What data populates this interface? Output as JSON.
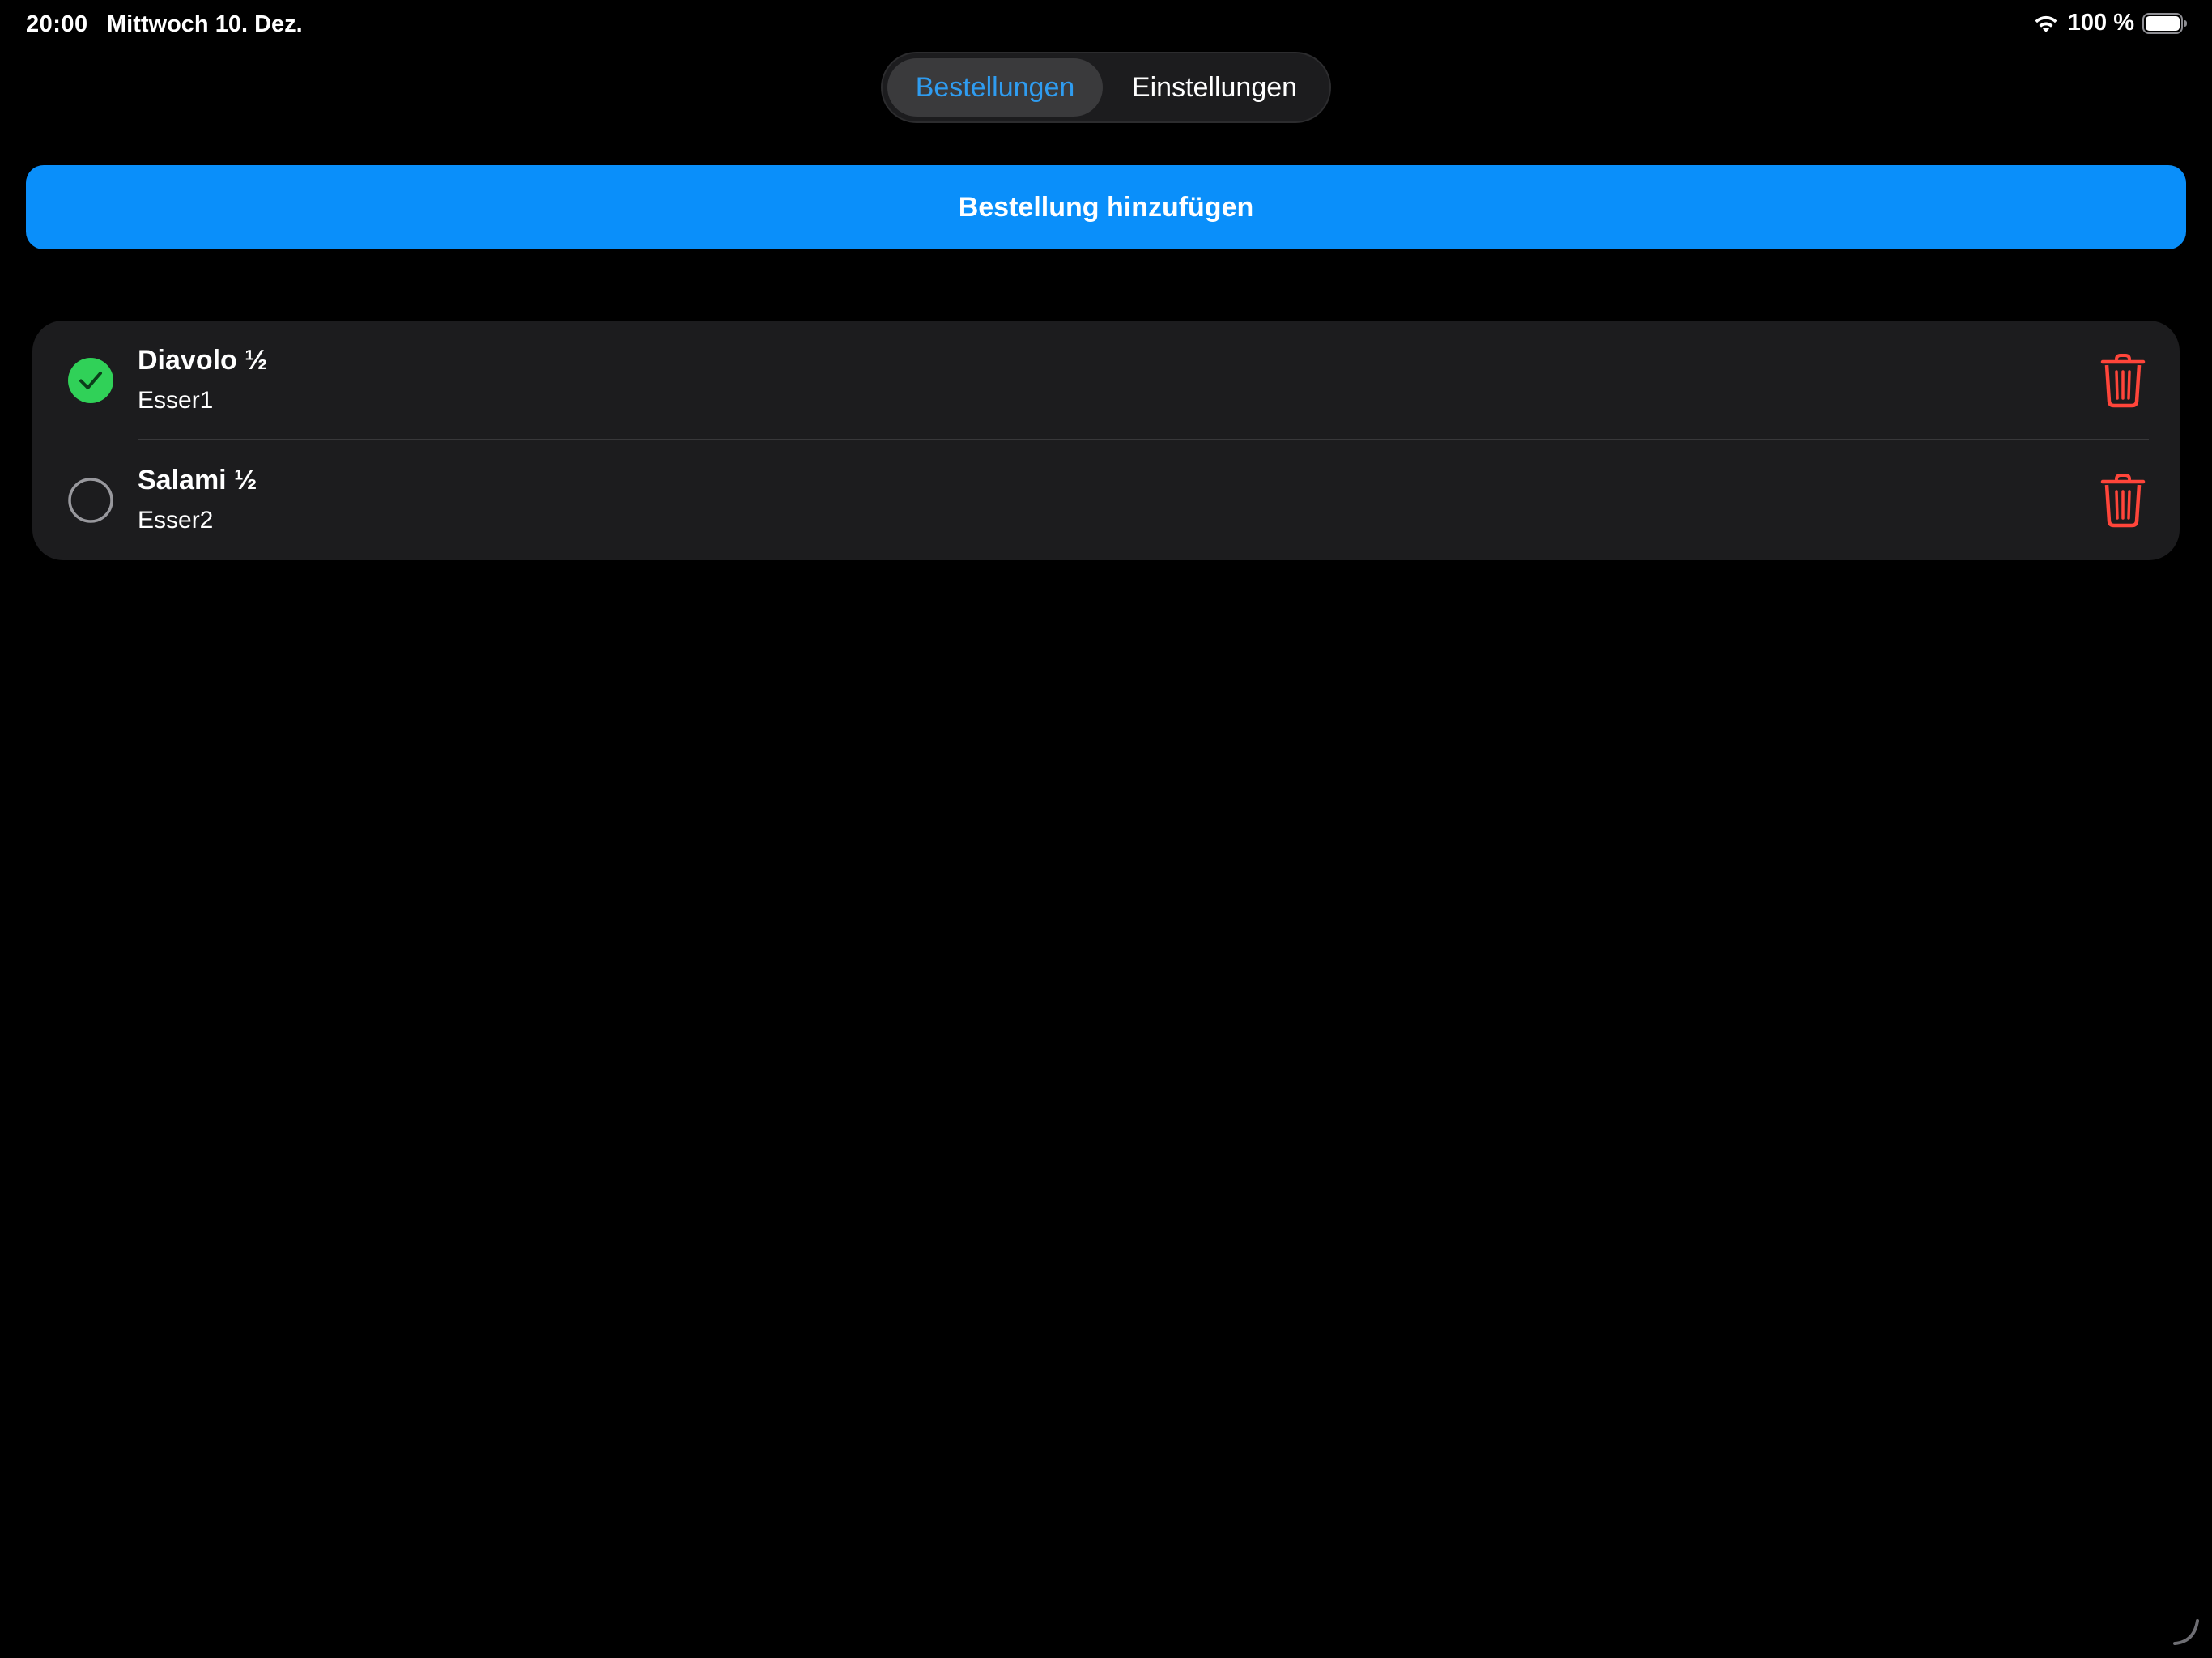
{
  "status_bar": {
    "time": "20:00",
    "date": "Mittwoch 10. Dez.",
    "battery_percent": "100 %",
    "battery_level": 1.0,
    "icons": [
      "wifi-icon",
      "battery-icon"
    ]
  },
  "tabs": [
    {
      "label": "Bestellungen",
      "selected": true
    },
    {
      "label": "Einstellungen",
      "selected": false
    }
  ],
  "add_button": {
    "label": "Bestellung hinzufügen"
  },
  "orders": [
    {
      "name": "Diavolo ½",
      "person": "Esser1",
      "done": true
    },
    {
      "name": "Salami ½",
      "person": "Esser2",
      "done": false
    }
  ],
  "colors": {
    "background": "#000000",
    "accent": "#0a8ffa",
    "selected_tab_text": "#2f9cf0",
    "done_green": "#30d158",
    "delete_red": "#ff453a",
    "card": "#1c1c1e"
  }
}
